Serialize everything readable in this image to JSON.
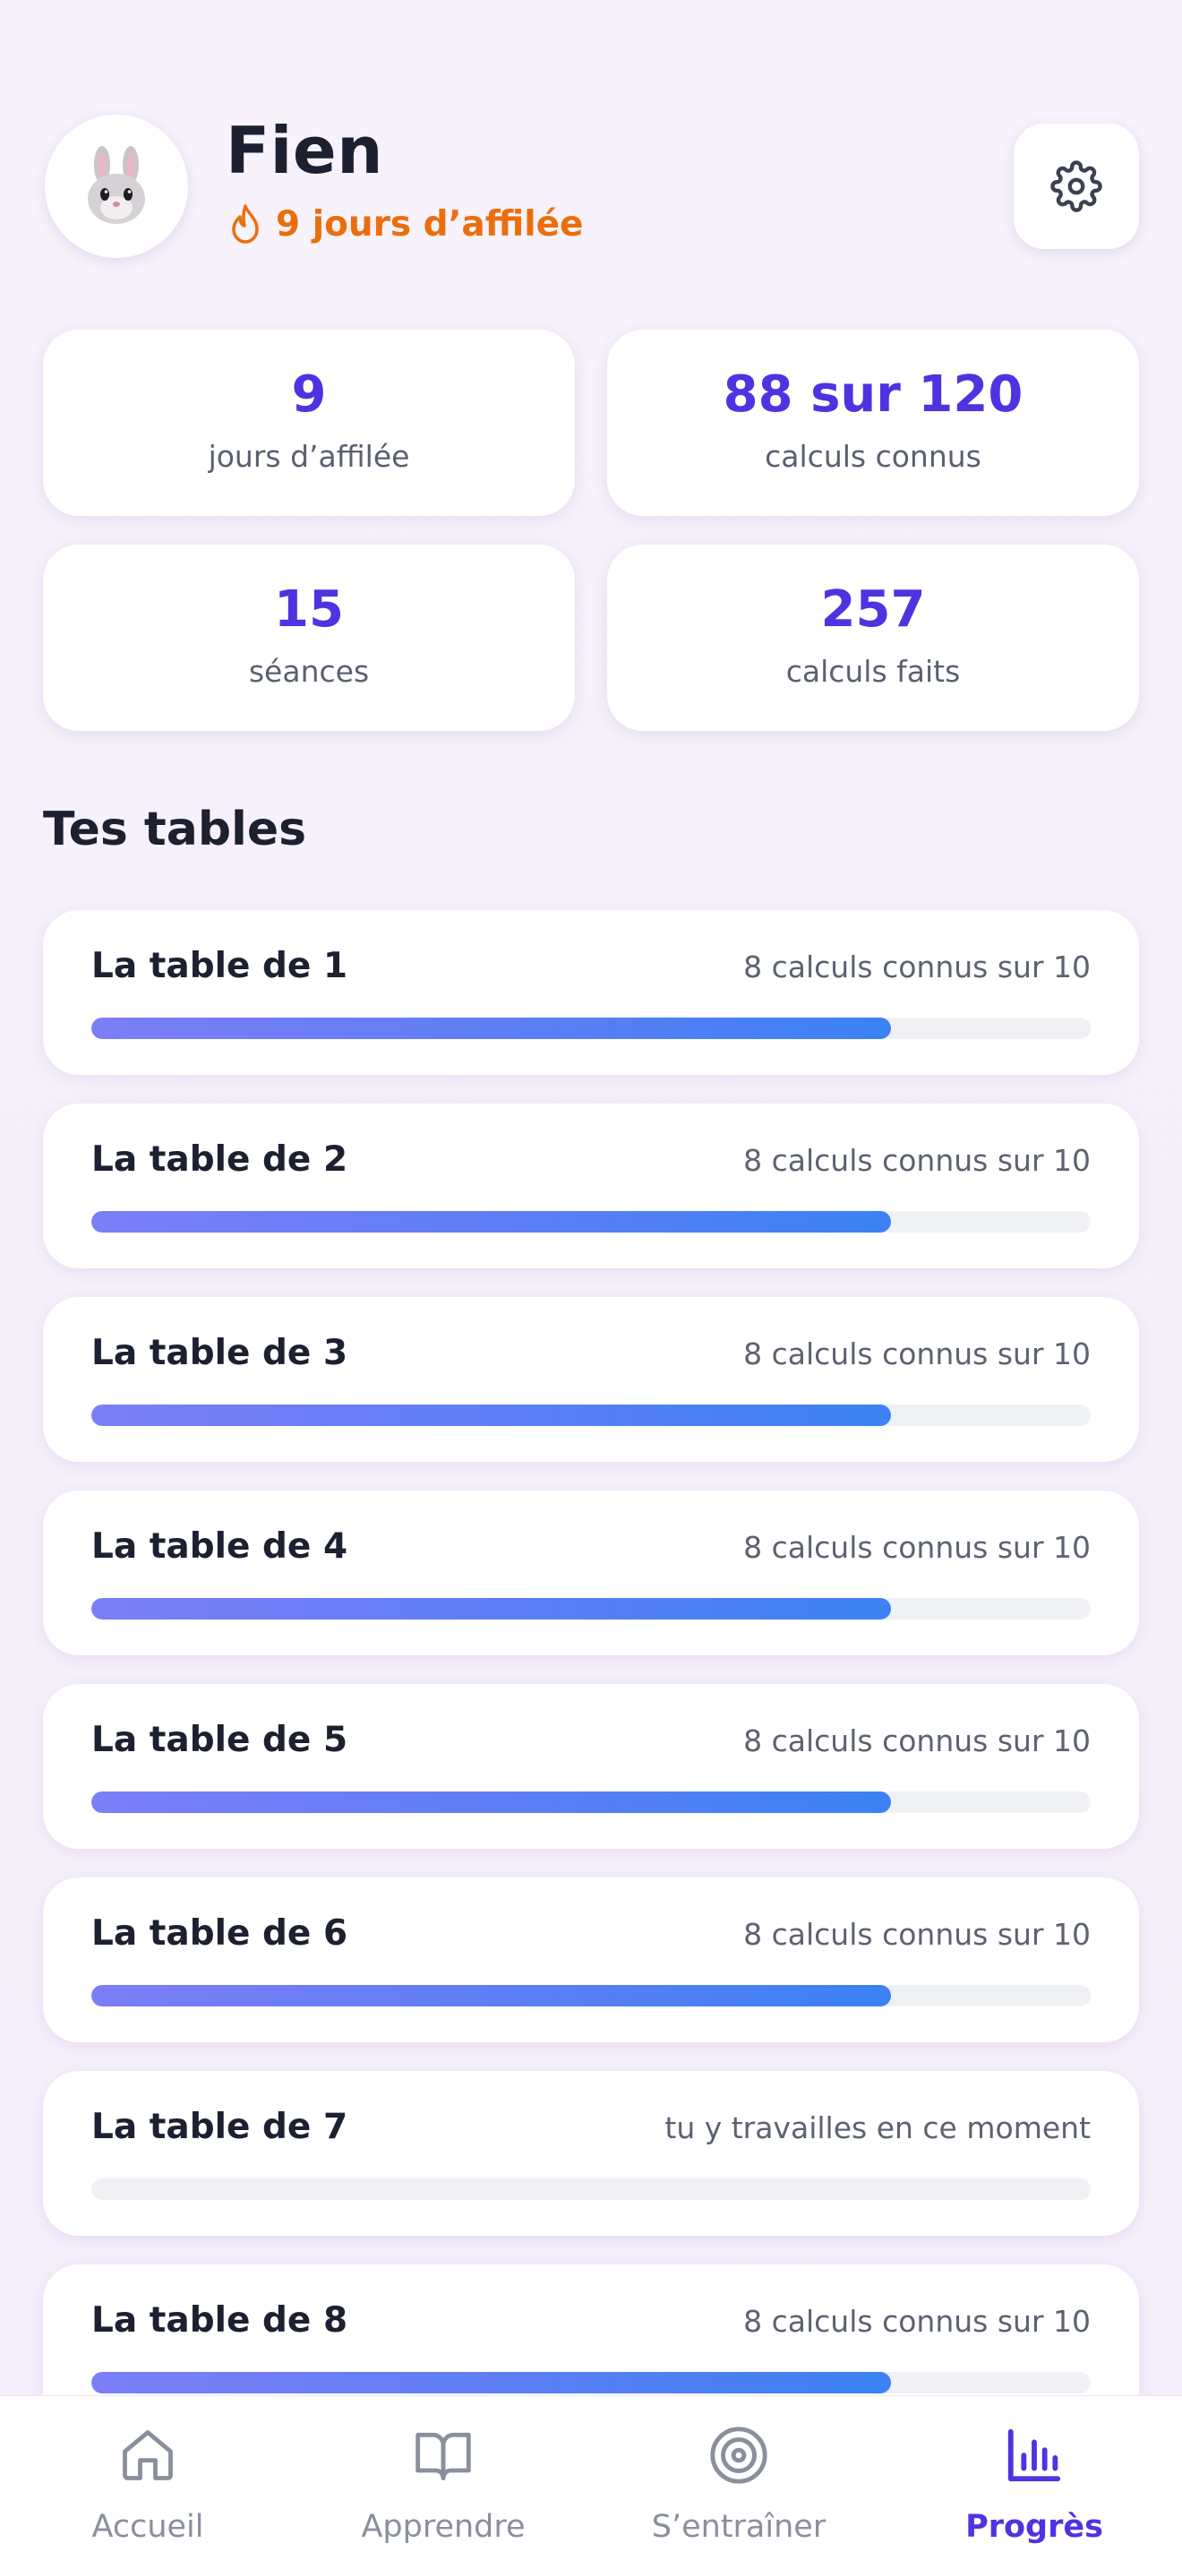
{
  "colors": {
    "accent": "#4f33e0",
    "streak": "#ea6f0b",
    "progress_start": "#7c7ef7",
    "progress_end": "#3b82f3",
    "track": "#f0f1f4",
    "inactive_nav": "#8a8f9c"
  },
  "header": {
    "avatar_emoji": "🐰",
    "name": "Fien",
    "streak_icon": "flame-icon",
    "streak_text": "9 jours d’affilée",
    "settings_icon": "gear-icon"
  },
  "stats": [
    {
      "value": "9",
      "label": "jours d’affilée"
    },
    {
      "value": "88 sur 120",
      "label": "calculs connus"
    },
    {
      "value": "15",
      "label": "séances"
    },
    {
      "value": "257",
      "label": "calculs faits"
    }
  ],
  "section_title": "Tes tables",
  "tables": [
    {
      "title": "La table de 1",
      "status": "8 calculs connus sur 10",
      "progress": 0.8
    },
    {
      "title": "La table de 2",
      "status": "8 calculs connus sur 10",
      "progress": 0.8
    },
    {
      "title": "La table de 3",
      "status": "8 calculs connus sur 10",
      "progress": 0.8
    },
    {
      "title": "La table de 4",
      "status": "8 calculs connus sur 10",
      "progress": 0.8
    },
    {
      "title": "La table de 5",
      "status": "8 calculs connus sur 10",
      "progress": 0.8
    },
    {
      "title": "La table de 6",
      "status": "8 calculs connus sur 10",
      "progress": 0.8
    },
    {
      "title": "La table de 7",
      "status": "tu y travailles en ce moment",
      "progress": 0
    },
    {
      "title": "La table de 8",
      "status": "8 calculs connus sur 10",
      "progress": 0.8
    }
  ],
  "nav": {
    "items": [
      {
        "label": "Accueil",
        "icon": "home-icon",
        "active": false
      },
      {
        "label": "Apprendre",
        "icon": "book-icon",
        "active": false
      },
      {
        "label": "S’entraîner",
        "icon": "target-icon",
        "active": false
      },
      {
        "label": "Progrès",
        "icon": "bar-chart-icon",
        "active": true
      }
    ]
  }
}
